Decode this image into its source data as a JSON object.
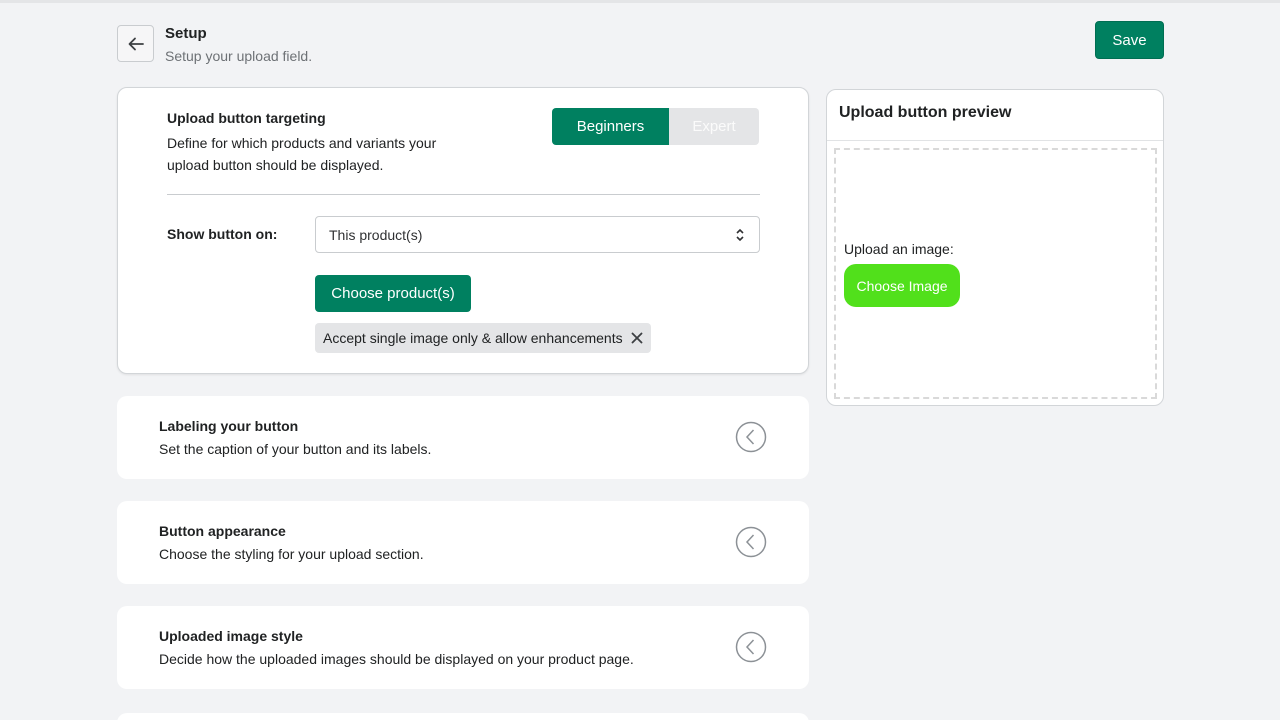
{
  "header": {
    "title": "Setup",
    "subtitle": "Setup your upload field.",
    "save_label": "Save"
  },
  "targeting": {
    "title": "Upload button targeting",
    "description": "Define for which products and variants your upload button should be displayed.",
    "toggle": {
      "beginners": "Beginners",
      "expert": "Expert",
      "active": "Beginners"
    },
    "show_label": "Show button on:",
    "select_value": "This product(s)",
    "choose_products_label": "Choose product(s)",
    "tag_label": "Accept single image only & allow enhancements"
  },
  "sections": [
    {
      "title": "Labeling your button",
      "description": "Set the caption of your button and its labels."
    },
    {
      "title": "Button appearance",
      "description": "Choose the styling for your upload section."
    },
    {
      "title": "Uploaded image style",
      "description": "Decide how the uploaded images should be displayed on your product page."
    }
  ],
  "preview": {
    "title": "Upload button preview",
    "upload_label": "Upload an image:",
    "button_label": "Choose Image"
  },
  "colors": {
    "primary": "#008060",
    "preview_button": "#51e01b",
    "background": "#f2f3f5"
  },
  "icons": {
    "back": "arrow-left-icon",
    "select": "select-arrows-icon",
    "remove": "close-icon",
    "expand": "chevron-left-circle-icon"
  }
}
